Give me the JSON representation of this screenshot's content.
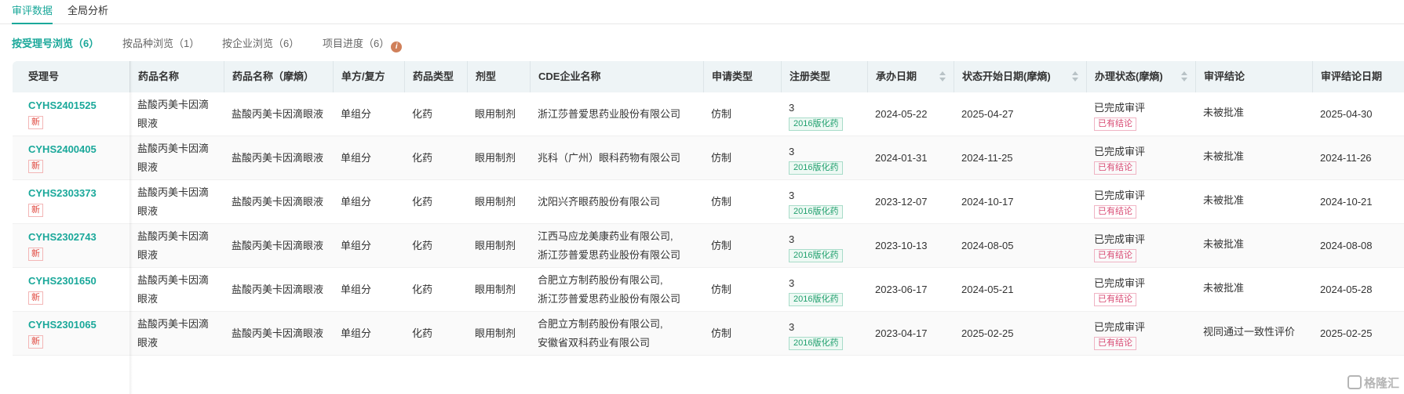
{
  "top_tabs": [
    {
      "label": "审评数据",
      "active": true
    },
    {
      "label": "全局分析",
      "active": false
    }
  ],
  "sub_tabs": [
    {
      "label": "按受理号浏览（6）",
      "active": true
    },
    {
      "label": "按品种浏览（1）",
      "active": false
    },
    {
      "label": "按企业浏览（6）",
      "active": false
    },
    {
      "label": "项目进度（6）",
      "active": false,
      "icon": "info-icon"
    }
  ],
  "columns": [
    "受理号",
    "药品名称",
    "药品名称（摩熵）",
    "单方/复方",
    "药品类型",
    "剂型",
    "CDE企业名称",
    "申请类型",
    "注册类型",
    "承办日期",
    "状态开始日期(摩熵)",
    "办理状态(摩熵)",
    "审评结论",
    "审评结论日期"
  ],
  "rows": [
    {
      "id": "CYHS2401525",
      "badge": "新",
      "name": "盐酸丙美卡因滴眼液",
      "name_mo": "盐酸丙美卡因滴眼液",
      "compound": "单组分",
      "type": "化药",
      "form": "眼用制剂",
      "company": [
        "浙江莎普爱思药业股份有限公司"
      ],
      "apply": "仿制",
      "reg_num": "3",
      "reg_tag": "2016版化药",
      "accept_date": "2024-05-22",
      "status_date": "2025-04-27",
      "status": "已完成审评",
      "status_tag": "已有结论",
      "conclusion": "未被批准",
      "conclusion_date": "2025-04-30"
    },
    {
      "id": "CYHS2400405",
      "badge": "新",
      "name": "盐酸丙美卡因滴眼液",
      "name_mo": "盐酸丙美卡因滴眼液",
      "compound": "单组分",
      "type": "化药",
      "form": "眼用制剂",
      "company": [
        "兆科（广州）眼科药物有限公司"
      ],
      "apply": "仿制",
      "reg_num": "3",
      "reg_tag": "2016版化药",
      "accept_date": "2024-01-31",
      "status_date": "2024-11-25",
      "status": "已完成审评",
      "status_tag": "已有结论",
      "conclusion": "未被批准",
      "conclusion_date": "2024-11-26"
    },
    {
      "id": "CYHS2303373",
      "badge": "新",
      "name": "盐酸丙美卡因滴眼液",
      "name_mo": "盐酸丙美卡因滴眼液",
      "compound": "单组分",
      "type": "化药",
      "form": "眼用制剂",
      "company": [
        "沈阳兴齐眼药股份有限公司"
      ],
      "apply": "仿制",
      "reg_num": "3",
      "reg_tag": "2016版化药",
      "accept_date": "2023-12-07",
      "status_date": "2024-10-17",
      "status": "已完成审评",
      "status_tag": "已有结论",
      "conclusion": "未被批准",
      "conclusion_date": "2024-10-21"
    },
    {
      "id": "CYHS2302743",
      "badge": "新",
      "name": "盐酸丙美卡因滴眼液",
      "name_mo": "盐酸丙美卡因滴眼液",
      "compound": "单组分",
      "type": "化药",
      "form": "眼用制剂",
      "company": [
        "江西马应龙美康药业有限公司,",
        "浙江莎普爱思药业股份有限公司"
      ],
      "apply": "仿制",
      "reg_num": "3",
      "reg_tag": "2016版化药",
      "accept_date": "2023-10-13",
      "status_date": "2024-08-05",
      "status": "已完成审评",
      "status_tag": "已有结论",
      "conclusion": "未被批准",
      "conclusion_date": "2024-08-08"
    },
    {
      "id": "CYHS2301650",
      "badge": "新",
      "name": "盐酸丙美卡因滴眼液",
      "name_mo": "盐酸丙美卡因滴眼液",
      "compound": "单组分",
      "type": "化药",
      "form": "眼用制剂",
      "company": [
        "合肥立方制药股份有限公司,",
        "浙江莎普爱思药业股份有限公司"
      ],
      "apply": "仿制",
      "reg_num": "3",
      "reg_tag": "2016版化药",
      "accept_date": "2023-06-17",
      "status_date": "2024-05-21",
      "status": "已完成审评",
      "status_tag": "已有结论",
      "conclusion": "未被批准",
      "conclusion_date": "2024-05-28"
    },
    {
      "id": "CYHS2301065",
      "badge": "新",
      "name": "盐酸丙美卡因滴眼液",
      "name_mo": "盐酸丙美卡因滴眼液",
      "compound": "单组分",
      "type": "化药",
      "form": "眼用制剂",
      "company": [
        "合肥立方制药股份有限公司,",
        "安徽省双科药业有限公司"
      ],
      "apply": "仿制",
      "reg_num": "3",
      "reg_tag": "2016版化药",
      "accept_date": "2023-04-17",
      "status_date": "2025-02-25",
      "status": "已完成审评",
      "status_tag": "已有结论",
      "conclusion": "视同通过一致性评价",
      "conclusion_date": "2025-02-25"
    }
  ],
  "watermark": "格隆汇"
}
